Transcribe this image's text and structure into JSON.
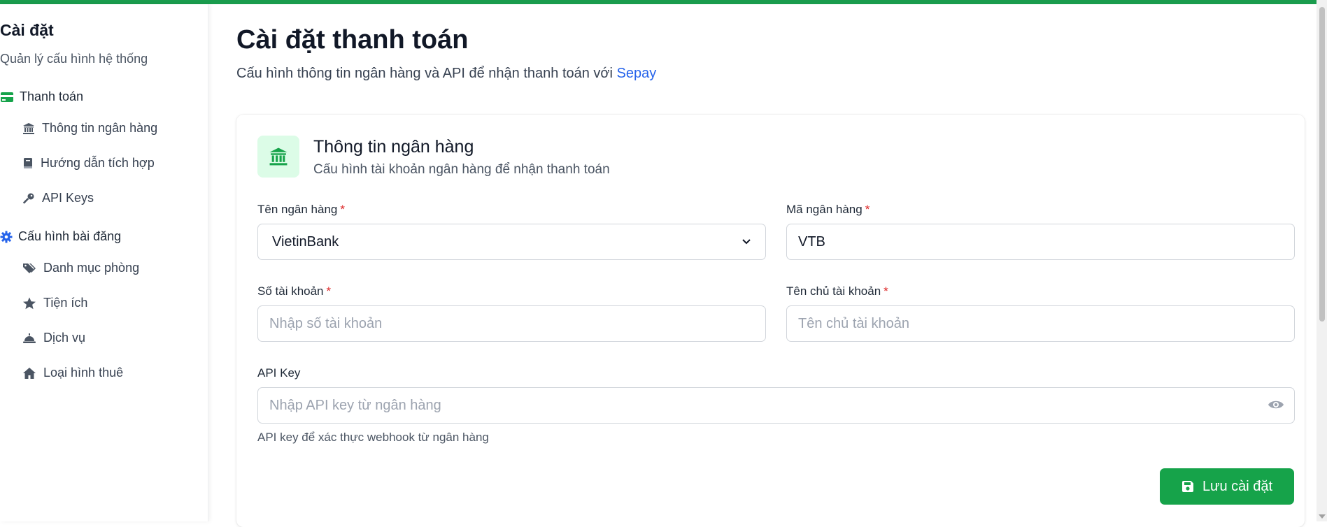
{
  "sidebar": {
    "title": "Cài đặt",
    "subtitle": "Quản lý cấu hình hệ thống",
    "groups": [
      {
        "label": "Thanh toán",
        "icon": "credit-card-icon",
        "items": [
          {
            "label": "Thông tin ngân hàng",
            "icon": "bank-icon"
          },
          {
            "label": "Hướng dẫn tích hợp",
            "icon": "book-icon"
          },
          {
            "label": "API Keys",
            "icon": "key-icon"
          }
        ]
      },
      {
        "label": "Cấu hình bài đăng",
        "icon": "gear-icon",
        "items": [
          {
            "label": "Danh mục phòng",
            "icon": "tags-icon"
          },
          {
            "label": "Tiện ích",
            "icon": "star-icon"
          },
          {
            "label": "Dịch vụ",
            "icon": "service-bell-icon"
          },
          {
            "label": "Loại hình thuê",
            "icon": "home-icon"
          }
        ]
      }
    ]
  },
  "main": {
    "title": "Cài đặt thanh toán",
    "description": "Cấu hình thông tin ngân hàng và API để nhận thanh toán với",
    "description_link": "Sepay",
    "card": {
      "title": "Thông tin ngân hàng",
      "subtitle": "Cấu hình tài khoản ngân hàng để nhận thanh toán",
      "fields": {
        "bank_name": {
          "label": "Tên ngân hàng",
          "required": "*",
          "value": "VietinBank"
        },
        "bank_code": {
          "label": "Mã ngân hàng",
          "required": "*",
          "value": "VTB"
        },
        "account_number": {
          "label": "Số tài khoản",
          "required": "*",
          "value": "",
          "placeholder": "Nhập số tài khoản"
        },
        "account_holder": {
          "label": "Tên chủ tài khoản",
          "required": "*",
          "value": "",
          "placeholder": "Tên chủ tài khoản"
        },
        "api_key": {
          "label": "API Key",
          "value": "",
          "placeholder": "Nhập API key từ ngân hàng",
          "hint": "API key để xác thực webhook từ ngân hàng"
        }
      },
      "save_label": "Lưu cài đặt"
    }
  },
  "colors": {
    "accent": "#16a34a",
    "top_bar": "#1a9c4d",
    "link": "#2563eb",
    "required": "#dc2626",
    "icon_bg": "#dcfce7"
  }
}
